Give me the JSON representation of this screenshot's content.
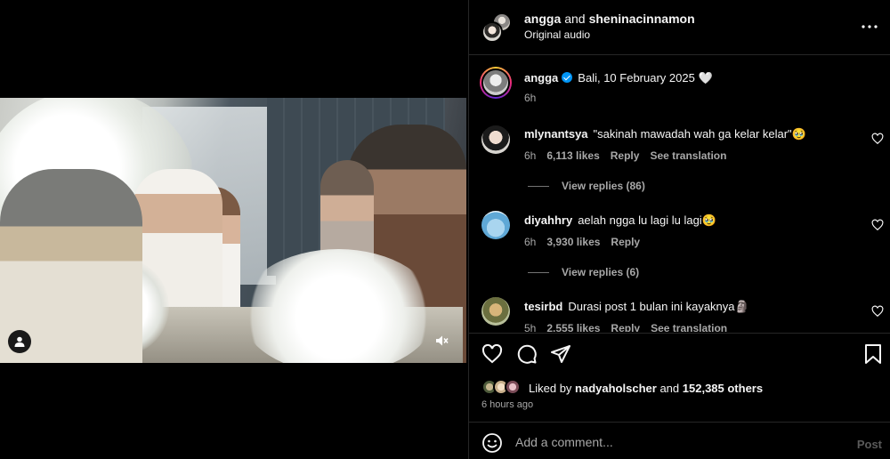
{
  "header": {
    "user1": "angga",
    "joiner": "and",
    "user2": "sheninacinnamon",
    "audio": "Original audio"
  },
  "caption": {
    "username": "angga",
    "text": "Bali, 10 February 2025",
    "emoji": "🤍",
    "time": "6h"
  },
  "comments": [
    {
      "username": "mlynantsya",
      "text": "\"sakinah mawadah wah ga kelar kelar\"",
      "emoji": "🥹",
      "time": "6h",
      "likes": "6,113 likes",
      "reply": "Reply",
      "translate": "See translation",
      "replies": "View replies (86)"
    },
    {
      "username": "diyahhry",
      "text": "aelah ngga lu lagi lu lagi",
      "emoji": "🥹",
      "time": "6h",
      "likes": "3,930 likes",
      "reply": "Reply",
      "replies": "View replies (6)"
    },
    {
      "username": "tesirbd",
      "text": "Durasi post 1 bulan ini kayaknya",
      "emoji": "🗿",
      "time": "5h",
      "likes": "2,555 likes",
      "reply": "Reply",
      "translate": "See translation"
    }
  ],
  "likes": {
    "prefix": "Liked by",
    "user": "nadyaholscher",
    "and": "and",
    "others": "152,385 others",
    "time": "6 hours ago"
  },
  "comment_bar": {
    "placeholder": "Add a comment...",
    "post_label": "Post"
  },
  "icons": [
    "user-tag-icon",
    "mute-icon",
    "more-icon",
    "heart-icon",
    "comment-icon",
    "share-icon",
    "bookmark-icon",
    "emoji-icon"
  ],
  "colors": {
    "background": "#000000",
    "text": "#f5f5f5",
    "secondary": "#a8a8a8",
    "verified": "#0095f6"
  }
}
